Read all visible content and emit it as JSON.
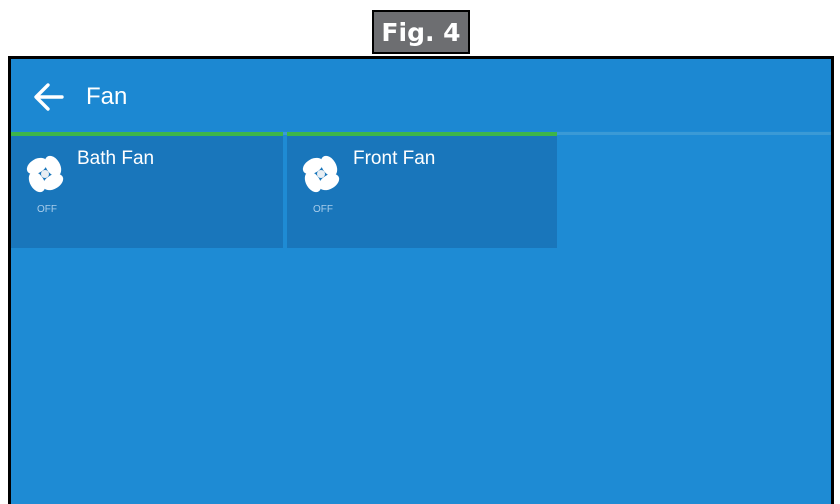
{
  "figure": {
    "label": "Fig. 4"
  },
  "header": {
    "back_icon": "arrow-left-icon",
    "title": "Fan"
  },
  "devices": [
    {
      "name": "Bath Fan",
      "status": "OFF",
      "icon": "fan-icon"
    },
    {
      "name": "Front Fan",
      "status": "OFF",
      "icon": "fan-icon"
    }
  ],
  "colors": {
    "screen_bg": "#1e8bd4",
    "tile_bg": "#1976bb",
    "active_indicator": "#3db54a",
    "figure_label_bg": "#6d6e71"
  }
}
